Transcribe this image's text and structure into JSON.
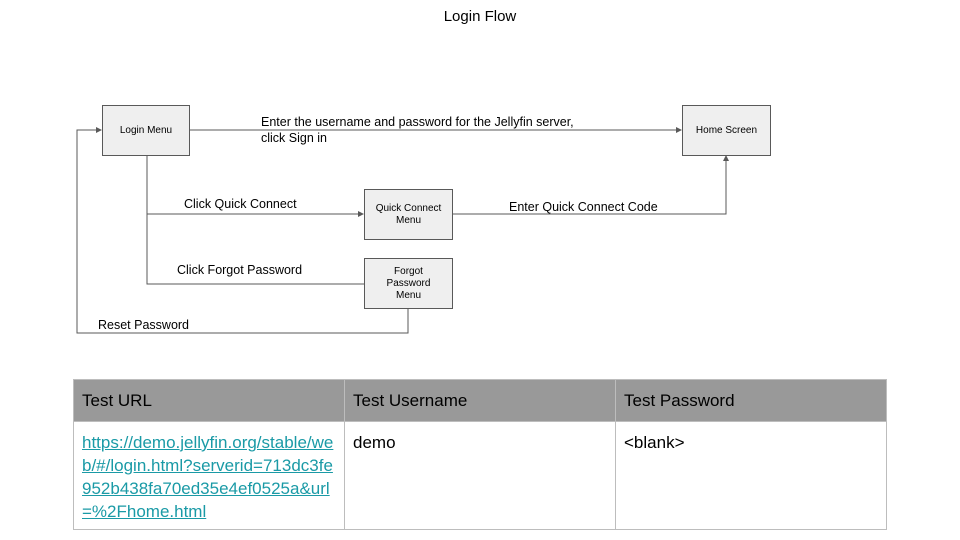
{
  "diagram": {
    "title": "Login Flow",
    "nodes": {
      "login_menu": "Login Menu",
      "home_screen": "Home Screen",
      "quick_connect_menu": "Quick Connect Menu",
      "forgot_password_menu": "Forgot Password Menu"
    },
    "edges": {
      "sign_in_line1": "Enter the username and password for the Jellyfin server,",
      "sign_in_line2": "click Sign in",
      "click_quick_connect": "Click Quick Connect",
      "enter_quick_connect_code": "Enter Quick Connect Code",
      "click_forgot_password": "Click Forgot Password",
      "reset_password": "Reset Password"
    },
    "colors": {
      "node_fill": "#efefef",
      "node_border": "#595959",
      "line": "#595959"
    }
  },
  "table": {
    "headers": [
      "Test URL",
      "Test Username",
      "Test Password"
    ],
    "row": {
      "url": "https://demo.jellyfin.org/stable/web/#/login.html?serverid=713dc3fe952b438fa70ed35e4ef0525a&url=%2Fhome.html",
      "username": "demo",
      "password": "<blank>"
    },
    "colors": {
      "header_bg": "#999999",
      "border": "#bdbdbd",
      "link": "#1a9aa6"
    }
  }
}
